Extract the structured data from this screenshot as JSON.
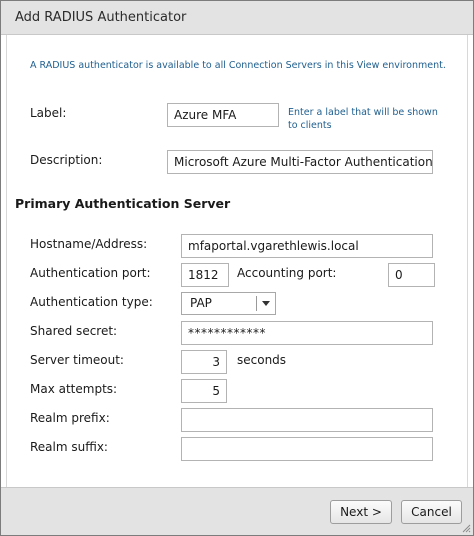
{
  "dialog": {
    "title": "Add RADIUS Authenticator",
    "notice": "A RADIUS authenticator is available to all Connection Servers in this View environment."
  },
  "label": {
    "label": "Label:",
    "value": "Azure MFA",
    "hint": "Enter a label that will be shown to clients"
  },
  "description": {
    "label": "Description:",
    "value": "Microsoft Azure Multi-Factor Authentication"
  },
  "primary_section": {
    "heading": "Primary Authentication Server",
    "hostname_label": "Hostname/Address:",
    "hostname_value": "mfaportal.vgarethlewis.local",
    "auth_port_label": "Authentication port:",
    "auth_port_value": "1812",
    "acct_port_label": "Accounting port:",
    "acct_port_value": "0",
    "auth_type_label": "Authentication type:",
    "auth_type_value": "PAP",
    "secret_label": "Shared secret:",
    "secret_value": "************",
    "timeout_label": "Server timeout:",
    "timeout_value": "3",
    "timeout_unit": "seconds",
    "max_attempts_label": "Max attempts:",
    "max_attempts_value": "5",
    "realm_prefix_label": "Realm prefix:",
    "realm_prefix_value": "",
    "realm_suffix_label": "Realm suffix:",
    "realm_suffix_value": ""
  },
  "footer": {
    "next_label": "Next >",
    "cancel_label": "Cancel"
  },
  "icons": {
    "dropdown": "chevron-down-icon",
    "resize": "resize-grip-icon"
  }
}
